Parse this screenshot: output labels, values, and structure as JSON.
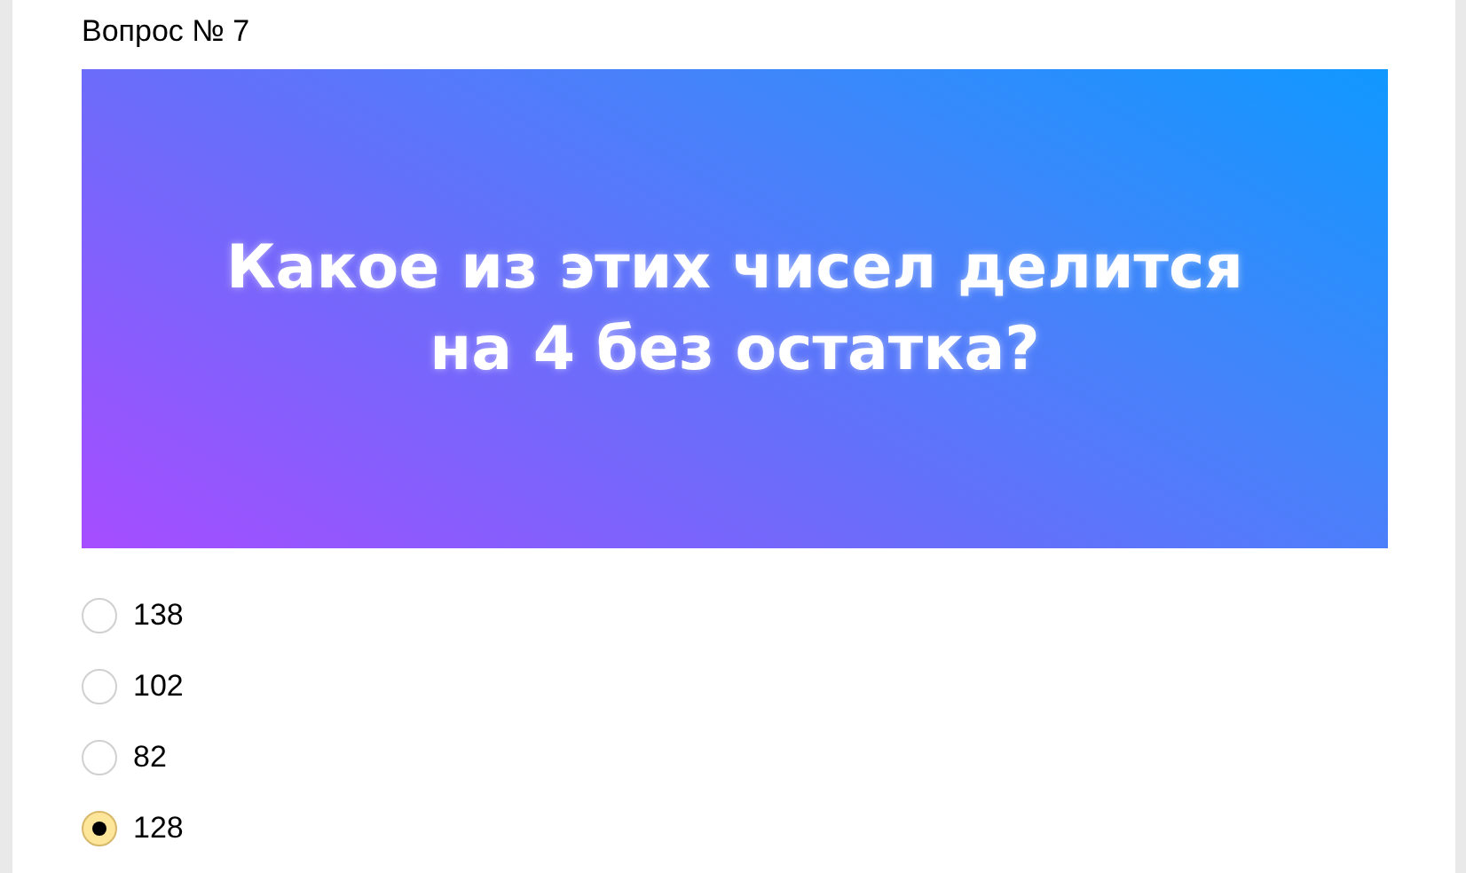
{
  "question": {
    "title": "Вопрос № 7",
    "banner_text": "Какое из этих чисел делится на 4 без остатка?"
  },
  "options": [
    {
      "label": "138",
      "selected": false
    },
    {
      "label": "102",
      "selected": false
    },
    {
      "label": "82",
      "selected": false
    },
    {
      "label": "128",
      "selected": true
    }
  ]
}
